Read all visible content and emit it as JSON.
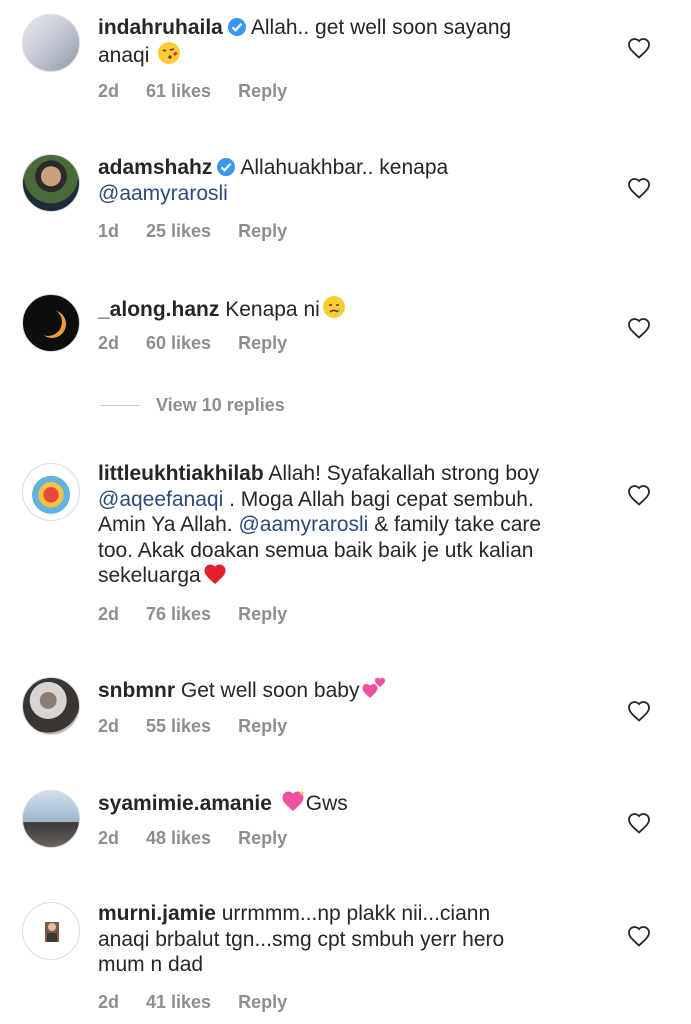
{
  "colors": {
    "text": "#262626",
    "meta": "#8e8e8e",
    "mention": "#2b4a7b",
    "verified": "#3897f0"
  },
  "comments": [
    {
      "user": "indahruhaila",
      "verified": true,
      "text": "Allah.. get well soon sayang",
      "text2": "anaqi",
      "emoji": "kissing-heart-emoji",
      "age": "2d",
      "likes": "61 likes",
      "reply": "Reply"
    },
    {
      "user": "adamshahz",
      "verified": true,
      "text": "Allahuakhbar.. kenapa",
      "mention": "@aamyrarosli",
      "age": "1d",
      "likes": "25 likes",
      "reply": "Reply"
    },
    {
      "user": "_along.hanz",
      "text": "Kenapa ni",
      "emoji": "crying-face-emoji",
      "age": "2d",
      "likes": "60 likes",
      "reply": "Reply"
    },
    {
      "user": "littleukhtiakhilab",
      "text": "Allah! Syafakallah strong boy",
      "mention1": "@aqeefanaqi",
      "text_b": ". Moga Allah bagi cepat sembuh.",
      "text_c": "Amin Ya Allah.",
      "mention2": "@aamyrarosli",
      "text_d": "& family take care",
      "text_e": "too. Akak doakan semua baik baik  je utk kalian",
      "text_f": "sekeluarga",
      "emoji": "red-heart-emoji",
      "age": "2d",
      "likes": "76 likes",
      "reply": "Reply"
    },
    {
      "user": "snbmnr",
      "text": "Get well soon baby",
      "emoji": "two-hearts-emoji",
      "age": "2d",
      "likes": "55 likes",
      "reply": "Reply"
    },
    {
      "user": "syamimie.amanie",
      "text": "Gws",
      "emoji": "sparkling-heart-emoji",
      "age": "2d",
      "likes": "48 likes",
      "reply": "Reply"
    },
    {
      "user": "murni.jamie",
      "text": "urrmmm...np plakk nii...ciann",
      "text2": "anaqi brbalut tgn...smg cpt smbuh yerr hero",
      "text3": "mum n dad",
      "age": "2d",
      "likes": "41 likes",
      "reply": "Reply"
    }
  ],
  "view_replies": "View 10 replies"
}
